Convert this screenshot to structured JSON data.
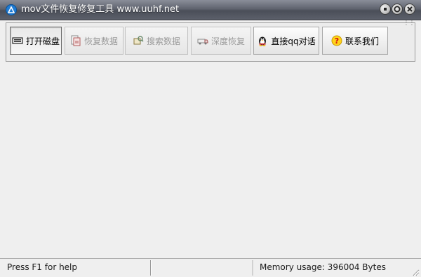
{
  "window": {
    "title": "mov文件恢复修复工具 www.uuhf.net",
    "controls": [
      "minimize",
      "maximize",
      "close"
    ]
  },
  "toolbar": {
    "buttons": [
      {
        "label": "打开磁盘",
        "icon": "disk-icon",
        "enabled": true
      },
      {
        "label": "恢复数据",
        "icon": "restore-data-icon",
        "enabled": false
      },
      {
        "label": "搜索数据",
        "icon": "search-data-icon",
        "enabled": false
      },
      {
        "label": "深度恢复",
        "icon": "deep-recover-icon",
        "enabled": false
      },
      {
        "label": "直接qq对话",
        "icon": "qq-penguin-icon",
        "enabled": true
      },
      {
        "label": "联系我们",
        "icon": "help-question-icon",
        "enabled": true
      }
    ]
  },
  "statusbar": {
    "help": "Press F1 for help",
    "middle": "",
    "memory": "Memory usage: 396004 Bytes"
  },
  "colors": {
    "titlebar": "#5f636e",
    "background": "#efefef",
    "disabled_text": "#9a9a9a"
  }
}
